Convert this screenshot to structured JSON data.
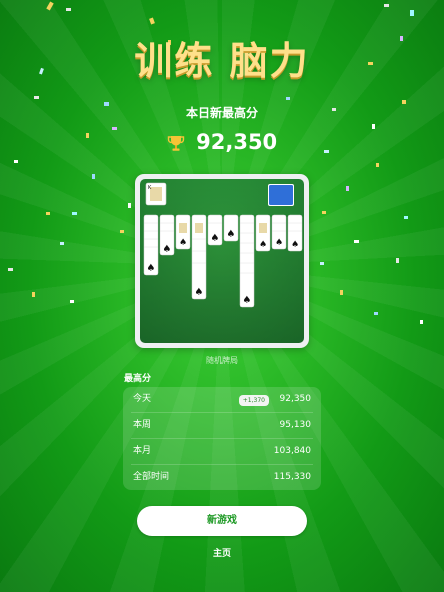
{
  "header": {
    "title": "训练 脑力",
    "daily_best_label": "本日新最高分",
    "daily_best_score": "92,350"
  },
  "board": {
    "caption": "随机牌局",
    "top_card_label": "K",
    "felt_color": "#1f7a2f",
    "stock_back_color": "#2f6fd8"
  },
  "best_scores": {
    "title": "最高分",
    "rows": [
      {
        "label": "今天",
        "badge": "+1,370",
        "value": "92,350"
      },
      {
        "label": "本周",
        "badge": "",
        "value": "95,130"
      },
      {
        "label": "本月",
        "badge": "",
        "value": "103,840"
      },
      {
        "label": "全部时间",
        "badge": "",
        "value": "115,330"
      }
    ]
  },
  "actions": {
    "new_game_label": "新游戏",
    "home_label": "主页"
  },
  "colors": {
    "accent_green": "#1f9a26",
    "title_gold": "#ffe08a"
  }
}
